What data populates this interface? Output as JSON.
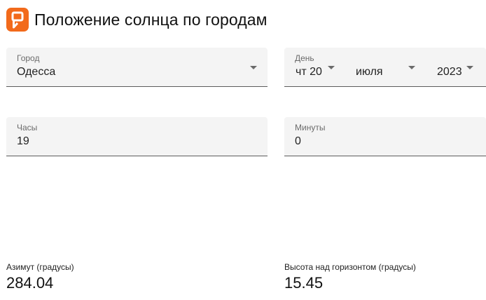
{
  "header": {
    "title": "Положение солнца по городам",
    "logo_icon": "app-logo-icon",
    "logo_color": "#f26a1b"
  },
  "city": {
    "label": "Город",
    "value": "Одесса"
  },
  "date": {
    "label": "День",
    "day": "чт 20",
    "month": "июля",
    "year": "2023"
  },
  "hours": {
    "label": "Часы",
    "value": "19"
  },
  "minutes": {
    "label": "Минуты",
    "value": "0"
  },
  "results": {
    "azimuth_label": "Азимут (градусы)",
    "azimuth_value": "284.04",
    "altitude_label": "Высота над горизонтом (градусы)",
    "altitude_value": "15.45"
  }
}
